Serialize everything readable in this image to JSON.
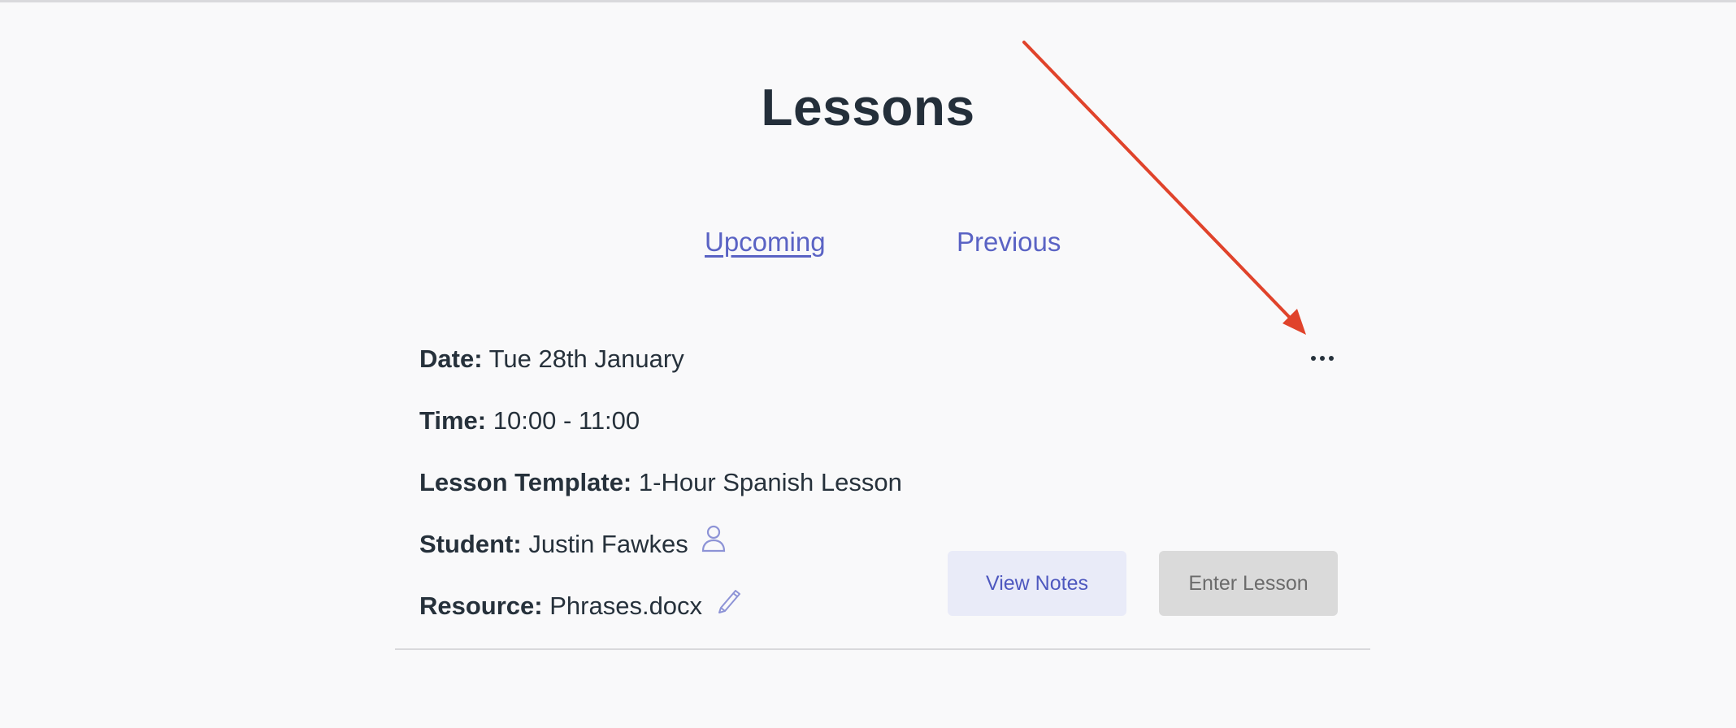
{
  "page": {
    "title": "Lessons"
  },
  "tabs": [
    {
      "label": "Upcoming",
      "active": true
    },
    {
      "label": "Previous",
      "active": false
    }
  ],
  "lesson": {
    "date": {
      "label": "Date:",
      "value": "Tue 28th January"
    },
    "time": {
      "label": "Time:",
      "value": "10:00 - 11:00"
    },
    "template": {
      "label": "Lesson Template:",
      "value": "1-Hour Spanish Lesson"
    },
    "student": {
      "label": "Student:",
      "value": "Justin Fawkes",
      "icon": "user-icon"
    },
    "resource": {
      "label": "Resource:",
      "value": "Phrases.docx",
      "icon": "pencil-icon"
    },
    "more_icon": "more-horizontal-icon",
    "buttons": {
      "view_notes": "View Notes",
      "enter_lesson": "Enter Lesson"
    }
  },
  "colors": {
    "accent": "#5a63c4",
    "text": "#26313b",
    "background": "#f9f9fa",
    "annotation": "#e0432b",
    "notes_button_bg": "#e9ebf8",
    "disabled_button_bg": "#dadada"
  }
}
